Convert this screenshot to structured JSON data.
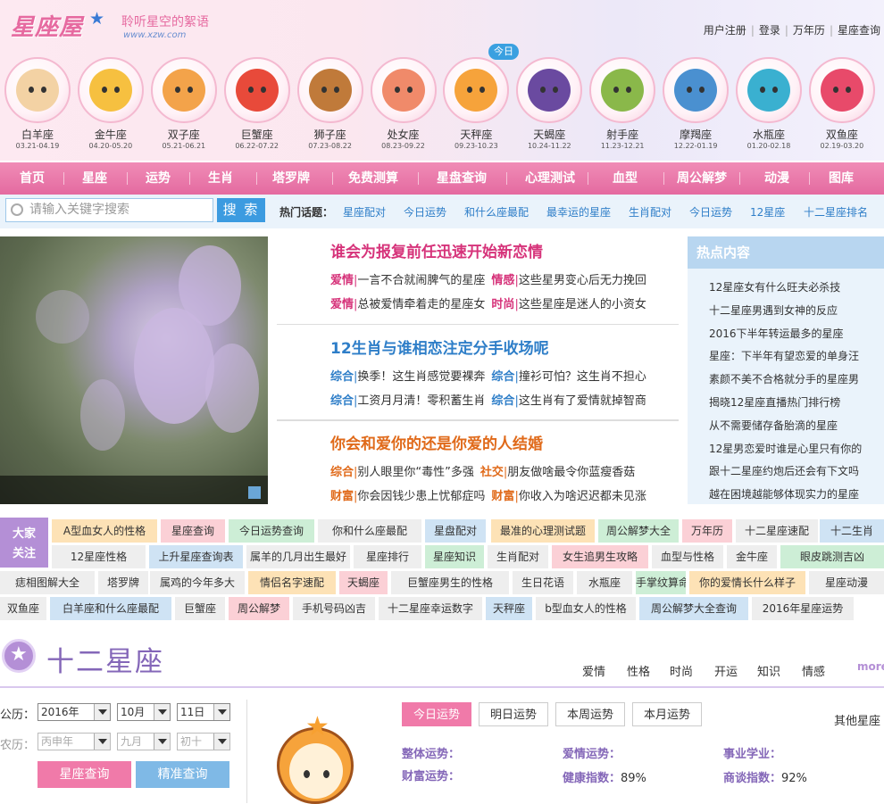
{
  "site": {
    "logo": "星座屋",
    "slogan": "聆听星空的絮语",
    "url": "www.xzw.com"
  },
  "top_links": [
    "用户注册",
    "登录",
    "万年历",
    "星座查询"
  ],
  "today_badge": "今日",
  "signs": [
    {
      "name": "白羊座",
      "date": "03.21-04.19",
      "color": "#f3d2a4"
    },
    {
      "name": "金牛座",
      "date": "04.20-05.20",
      "color": "#f6c040"
    },
    {
      "name": "双子座",
      "date": "05.21-06.21",
      "color": "#f3a34a"
    },
    {
      "name": "巨蟹座",
      "date": "06.22-07.22",
      "color": "#e84a3a"
    },
    {
      "name": "狮子座",
      "date": "07.23-08.22",
      "color": "#c07a3a"
    },
    {
      "name": "处女座",
      "date": "08.23-09.22",
      "color": "#f08a6a"
    },
    {
      "name": "天秤座",
      "date": "09.23-10.23",
      "color": "#f6a33b"
    },
    {
      "name": "天蝎座",
      "date": "10.24-11.22",
      "color": "#6a4aa0"
    },
    {
      "name": "射手座",
      "date": "11.23-12.21",
      "color": "#8ab84a"
    },
    {
      "name": "摩羯座",
      "date": "12.22-01.19",
      "color": "#4a90d0"
    },
    {
      "name": "水瓶座",
      "date": "01.20-02.18",
      "color": "#3ab0d0"
    },
    {
      "name": "双鱼座",
      "date": "02.19-03.20",
      "color": "#e84a6a"
    }
  ],
  "nav": [
    "首页",
    "星座",
    "运势",
    "生肖",
    "塔罗牌",
    "免费测算",
    "星盘查询",
    "心理测试",
    "血型",
    "周公解梦",
    "动漫",
    "图库"
  ],
  "search": {
    "placeholder": "请输入关键字搜索",
    "button": "搜 索"
  },
  "hot_label": "热门话题：",
  "hot_topics": [
    "星座配对",
    "今日运势",
    "和什么座最配",
    "最幸运的星座",
    "生肖配对",
    "今日运势",
    "12星座",
    "十二星座排名"
  ],
  "features": [
    {
      "title": "谁会为报复前任迅速开始新恋情",
      "color": "#d6337a",
      "lines": [
        [
          {
            "tag": "爱情",
            "text": "一言不合就闹脾气的星座"
          },
          {
            "tag": "情感",
            "text": "这些星男变心后无力挽回"
          }
        ],
        [
          {
            "tag": "爱情",
            "text": "总被爱情牵着走的星座女"
          },
          {
            "tag": "时尚",
            "text": "这些星座是迷人的小资女"
          }
        ]
      ]
    },
    {
      "title": "12生肖与谁相恋注定分手收场呢",
      "color": "#2e7ec8",
      "lines": [
        [
          {
            "tag": "综合",
            "text": "换季！这生肖感觉要裸奔"
          },
          {
            "tag": "综合",
            "text": "撞衫可怕？这生肖不担心"
          }
        ],
        [
          {
            "tag": "综合",
            "text": "工资月月清！零积蓄生肖"
          },
          {
            "tag": "综合",
            "text": "这生肖有了爱情就掉智商"
          }
        ]
      ]
    },
    {
      "title": "你会和爱你的还是你爱的人结婚",
      "color": "#e06a1a",
      "lines": [
        [
          {
            "tag": "综合",
            "text": "别人眼里你“毒性”多强"
          },
          {
            "tag": "社交",
            "text": "朋友做啥最令你蓝瘦香菇"
          }
        ],
        [
          {
            "tag": "财富",
            "text": "你会因钱少患上忧郁症吗"
          },
          {
            "tag": "财富",
            "text": "你收入为啥迟迟都未见涨"
          }
        ]
      ]
    }
  ],
  "hot_box": {
    "title": "热点内容",
    "items": [
      "12星座女有什么旺夫必杀技",
      "十二星座男遇到女神的反应",
      "2016下半年转运最多的星座",
      "星座：下半年有望恋爱的单身汪",
      "素颜不美不合格就分手的星座男",
      "揭晓12星座直播热门排行榜",
      "从不需要储存备胎滴的星座",
      "12星男恋爱时谁是心里只有你的",
      "跟十二星座约炮后还会有下文吗",
      "越在困境越能够体现实力的星座"
    ]
  },
  "tag_label": "大家关注",
  "tags": [
    [
      "A型血女人的性格",
      "星座查询",
      "今日运势查询",
      "你和什么座最配",
      "星盘配对",
      "最准的心理测试题",
      "周公解梦大全",
      "万年历",
      "十二星座速配",
      "十二生肖"
    ],
    [
      "12星座性格",
      "上升星座查询表",
      "属羊的几月出生最好",
      "星座排行",
      "星座知识",
      "生肖配对",
      "女生追男生攻略",
      "血型与性格",
      "金牛座",
      "眼皮跳测吉凶"
    ],
    [
      "痣相图解大全",
      "塔罗牌",
      "属鸡的今年多大",
      "情侣名字速配",
      "天蝎座",
      "巨蟹座男生的性格",
      "生日花语",
      "水瓶座",
      "手掌纹算命",
      "你的爱情长什么样子",
      "星座动漫"
    ],
    [
      "双鱼座",
      "白羊座和什么座最配",
      "巨蟹座",
      "周公解梦",
      "手机号码凶吉",
      "十二星座幸运数字",
      "天秤座",
      "b型血女人的性格",
      "周公解梦大全查询",
      "2016年星座运势"
    ]
  ],
  "section": {
    "title": "十二星座",
    "tabs": [
      "爱情",
      "性格",
      "时尚",
      "开运",
      "知识",
      "情感"
    ],
    "more": "more"
  },
  "form": {
    "solar_label": "公历：",
    "lunar_label": "农历：",
    "year": "2016年",
    "month": "10月",
    "day": "11日",
    "lunar_year": "丙申年 (2016)",
    "lunar_month": "九月",
    "lunar_day": "初十",
    "btn_query": "星座查询",
    "btn_precise": "精准查询"
  },
  "fortune": {
    "tabs": [
      "今日运势",
      "明日运势",
      "本周运势",
      "本月运势"
    ],
    "other": "其他星座",
    "overall": "整体运势：",
    "love": "爱情运势：",
    "career": "事业学业：",
    "wealth": "财富运势：",
    "health_label": "健康指数：",
    "health": "89%",
    "nego_label": "商谈指数：",
    "nego": "92%"
  }
}
